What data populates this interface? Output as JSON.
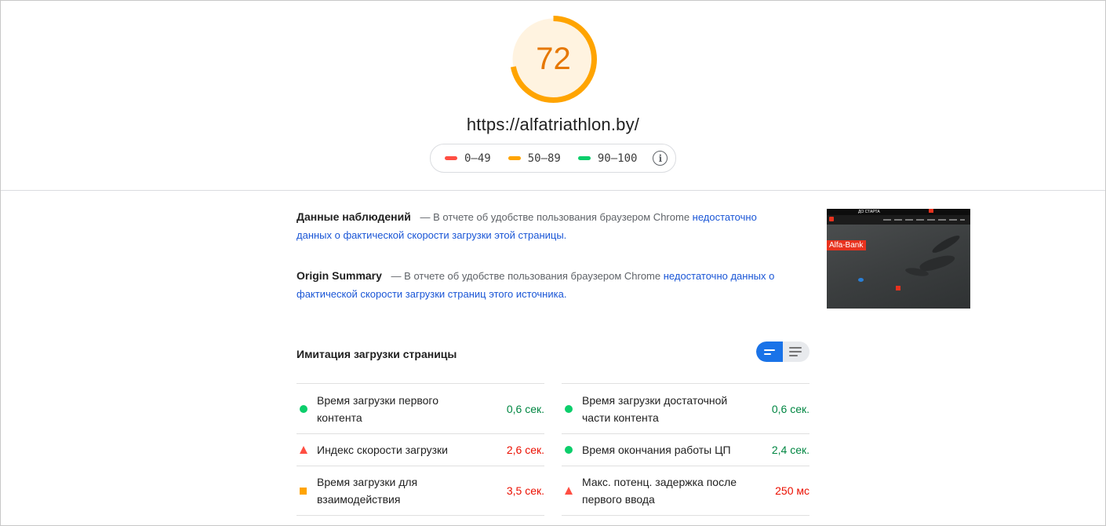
{
  "header": {
    "score": "72",
    "score_fraction": 0.72,
    "score_color": "#ffa400",
    "score_bg": "#fff3e0",
    "url": "https://alfatriathlon.by/",
    "legend": [
      {
        "label": "0–49",
        "color": "#ff4e42"
      },
      {
        "label": "50–89",
        "color": "#ffa400"
      },
      {
        "label": "90–100",
        "color": "#0cce6b"
      }
    ],
    "info_icon": "info-icon"
  },
  "field_data": {
    "title": "Данные наблюдений",
    "text": "— В отчете об удобстве пользования браузером Chrome",
    "link": "недостаточно данных о фактической скорости загрузки этой страницы."
  },
  "origin_summary": {
    "title": "Origin Summary",
    "text": "— В отчете об удобстве пользования браузером Chrome",
    "link": "недостаточно данных о фактической скорости загрузки страниц этого источника."
  },
  "thumbnail": {
    "top_bar_text": "ДО СТАРТА",
    "brand_label": "Alfa-Bank"
  },
  "lab_data": {
    "title": "Имитация загрузки страницы",
    "toggle": {
      "active": "bar-view-icon",
      "inactive": "list-view-icon"
    },
    "left_metrics": [
      {
        "name": "Время загрузки первого контента",
        "value": "0,6 сек.",
        "status": "green"
      },
      {
        "name": "Индекс скорости загрузки",
        "value": "2,6 сек.",
        "status": "red"
      },
      {
        "name": "Время загрузки для взаимодействия",
        "value": "3,5 сек.",
        "status": "orange"
      }
    ],
    "right_metrics": [
      {
        "name": "Время загрузки достаточной части контента",
        "value": "0,6 сек.",
        "status": "green"
      },
      {
        "name": "Время окончания работы ЦП",
        "value": "2,4 сек.",
        "status": "green"
      },
      {
        "name": "Макс. потенц. задержка после первого ввода",
        "value": "250 мс",
        "status": "red"
      }
    ]
  }
}
